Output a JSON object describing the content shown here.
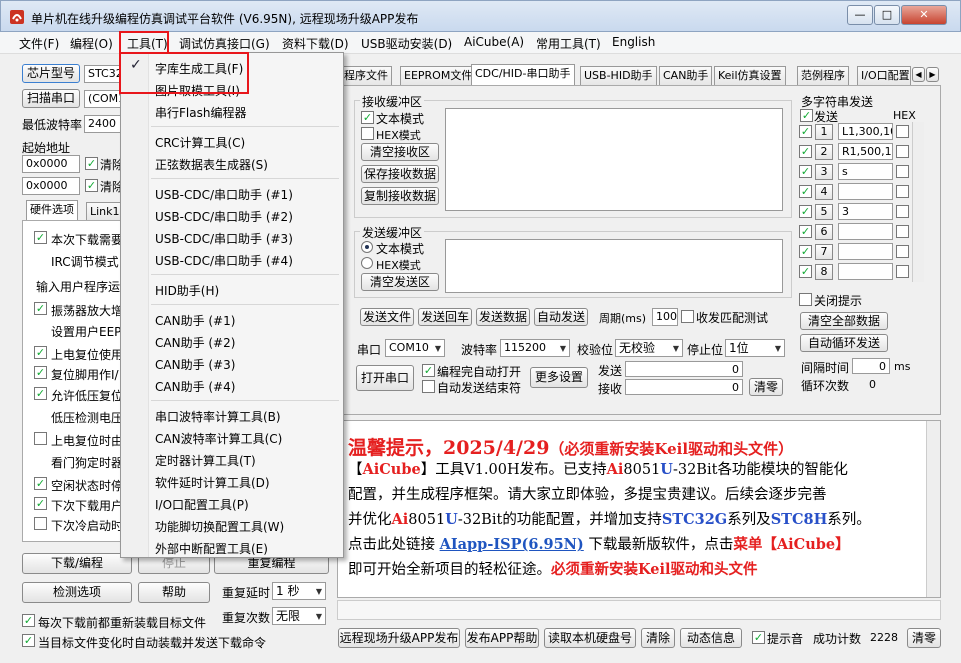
{
  "window": {
    "title": "单片机在线升级编程仿真调试平台软件 (V6.95N), 远程现场升级APP发布",
    "btn_min": "—",
    "btn_max": "□",
    "btn_close": "✕"
  },
  "menubar": [
    "文件(F)",
    "编程(O)",
    "工具(T)",
    "调试仿真接口(G)",
    "资料下载(D)",
    "USB驱动安装(D)",
    "AiCube(A)",
    "常用工具(T)",
    "English"
  ],
  "left": {
    "chip_btn": "芯片型号",
    "chip_val": "STC32",
    "scan_btn": "扫描串口",
    "port_val": "(COM10",
    "min_baud_label": "最低波特率",
    "min_baud_val": "2400",
    "start_addr_label": "起始地址",
    "addr1": "0x0000",
    "addr2": "0x0000",
    "clear1": "清除",
    "clear2": "清除",
    "tabs": [
      "硬件选项",
      "Link1"
    ],
    "options": [
      "本次下载需要",
      "IRC调节模式",
      "输入用户程序运",
      "振荡器放大增",
      "设置用户EEPR",
      "上电复位使用",
      "复位脚用作I/",
      "允许低压复位",
      "低压检测电压",
      "上电复位时由",
      "看门狗定时器",
      "空闲状态时停",
      "下次下载用户",
      "下次冷启动时"
    ],
    "download_btn": "下载/编程",
    "stop_btn": "停止",
    "reprogram_btn": "重复编程",
    "check_btn": "检测选项",
    "help_btn": "帮助",
    "repeat_delay_label": "重复延时",
    "repeat_delay_val": "1 秒",
    "repeat_count_label": "重复次数",
    "repeat_count_val": "无限",
    "reload_opt": "每次下载前都重新装载目标文件",
    "autoload_opt": "当目标文件变化时自动装载并发送下载命令"
  },
  "tabs": [
    "程序文件",
    "EEPROM文件",
    "CDC/HID-串口助手",
    "USB-HID助手",
    "CAN助手",
    "Keil仿真设置",
    "范例程序",
    "I/O口配置"
  ],
  "serial": {
    "recv_group": "接收缓冲区",
    "text_mode": "文本模式",
    "hex_mode": "HEX模式",
    "clear_recv": "清空接收区",
    "save_recv": "保存接收数据",
    "copy_recv": "复制接收数据",
    "send_group": "发送缓冲区",
    "send_text_mode": "文本模式",
    "send_hex_mode": "HEX模式",
    "clear_send": "清空发送区",
    "send_file": "发送文件",
    "send_return": "发送回车",
    "send_data": "发送数据",
    "auto_send": "自动发送",
    "period_label": "周期(ms)",
    "period_val": "100",
    "match_test": "收发匹配测试",
    "port_label": "串口",
    "port_val": "COM10",
    "baud_label": "波特率",
    "baud_val": "115200",
    "parity_label": "校验位",
    "parity_val": "无校验",
    "stop_label": "停止位",
    "stop_val": "1位",
    "open_btn": "打开串口",
    "auto_open": "编程完自动打开",
    "auto_end": "自动发送结束符",
    "more_btn": "更多设置",
    "send_count_label": "发送",
    "send_count": "0",
    "recv_count_label": "接收",
    "recv_count": "0",
    "clear_btn": "清零"
  },
  "multi": {
    "title": "多字符串发送",
    "send": "发送",
    "hex": "HEX",
    "rows": [
      {
        "n": "1",
        "v": "L1,300,10"
      },
      {
        "n": "2",
        "v": "R1,500,10"
      },
      {
        "n": "3",
        "v": "s"
      },
      {
        "n": "4",
        "v": ""
      },
      {
        "n": "5",
        "v": "3"
      },
      {
        "n": "6",
        "v": ""
      },
      {
        "n": "7",
        "v": ""
      },
      {
        "n": "8",
        "v": ""
      }
    ],
    "close_tip": "关闭提示",
    "clear_all": "清空全部数据",
    "auto_loop": "自动循环发送",
    "interval_label": "间隔时间",
    "interval_val": "0",
    "interval_unit": "ms",
    "loop_label": "循环次数",
    "loop_val": "0"
  },
  "menu": {
    "items": [
      [
        "字库生成工具(F)",
        "图片取模工具(I)",
        "串行Flash编程器"
      ],
      [
        "CRC计算工具(C)",
        "正弦数据表生成器(S)"
      ],
      [
        "USB-CDC/串口助手 (#1)",
        "USB-CDC/串口助手 (#2)",
        "USB-CDC/串口助手 (#3)",
        "USB-CDC/串口助手 (#4)"
      ],
      [
        "HID助手(H)"
      ],
      [
        "CAN助手 (#1)",
        "CAN助手 (#2)",
        "CAN助手 (#3)",
        "CAN助手 (#4)"
      ],
      [
        "串口波特率计算工具(B)",
        "CAN波特率计算工具(C)",
        "定时器计算工具(T)",
        "软件延时计算工具(D)",
        "I/O口配置工具(P)",
        "功能脚切换配置工具(W)",
        "外部中断配置工具(E)"
      ]
    ],
    "check": "✓"
  },
  "info": {
    "l1a": "温馨提示，2025/4/29",
    "l1b": "（必须重新安装Keil驱动和头文件）",
    "l2a": "【",
    "l2b": "AiCube",
    "l2c": "】工具V1.00H发布。已支持",
    "l2d": "Ai",
    "l2e": "8051",
    "l2f": "U",
    "l2g": "-32Bit",
    "l2h": "各功能模块的智能化",
    "l3": "配置，并生成程序框架。请大家立即体验，多提宝贵建议。后续会逐步完善",
    "l4a": "并优化",
    "l4b": "Ai",
    "l4c": "8051",
    "l4d": "U",
    "l4e": "-32Bit",
    "l4f": "的功能配置，并增加支持",
    "l4g": "STC32G",
    "l4h": "系列及",
    "l4i": "STC8H",
    "l4j": "系列。",
    "l5a": "点击此处链接 ",
    "l5b": "AIapp-ISP(6.95N)",
    "l5c": " 下载最新版软件，点击",
    "l5d": "菜单【",
    "l5e": "AiCube",
    "l5f": "】",
    "l6a": "即可开始全新项目的轻松征途。",
    "l6b": "必须重新安装Keil驱动和头文件"
  },
  "bottom": {
    "remote_btn": "远程现场升级APP发布",
    "publish_btn": "发布APP帮助",
    "read_btn": "读取本机硬盘号",
    "clear_btn": "清除",
    "dyn_btn": "动态信息",
    "sound": "提示音",
    "success_label": "成功计数",
    "success_val": "2228",
    "clear2_btn": "清零"
  },
  "colors": {
    "highlight": "#e8161b",
    "accent_red": "#e52020",
    "accent_blue": "#2850c8"
  }
}
